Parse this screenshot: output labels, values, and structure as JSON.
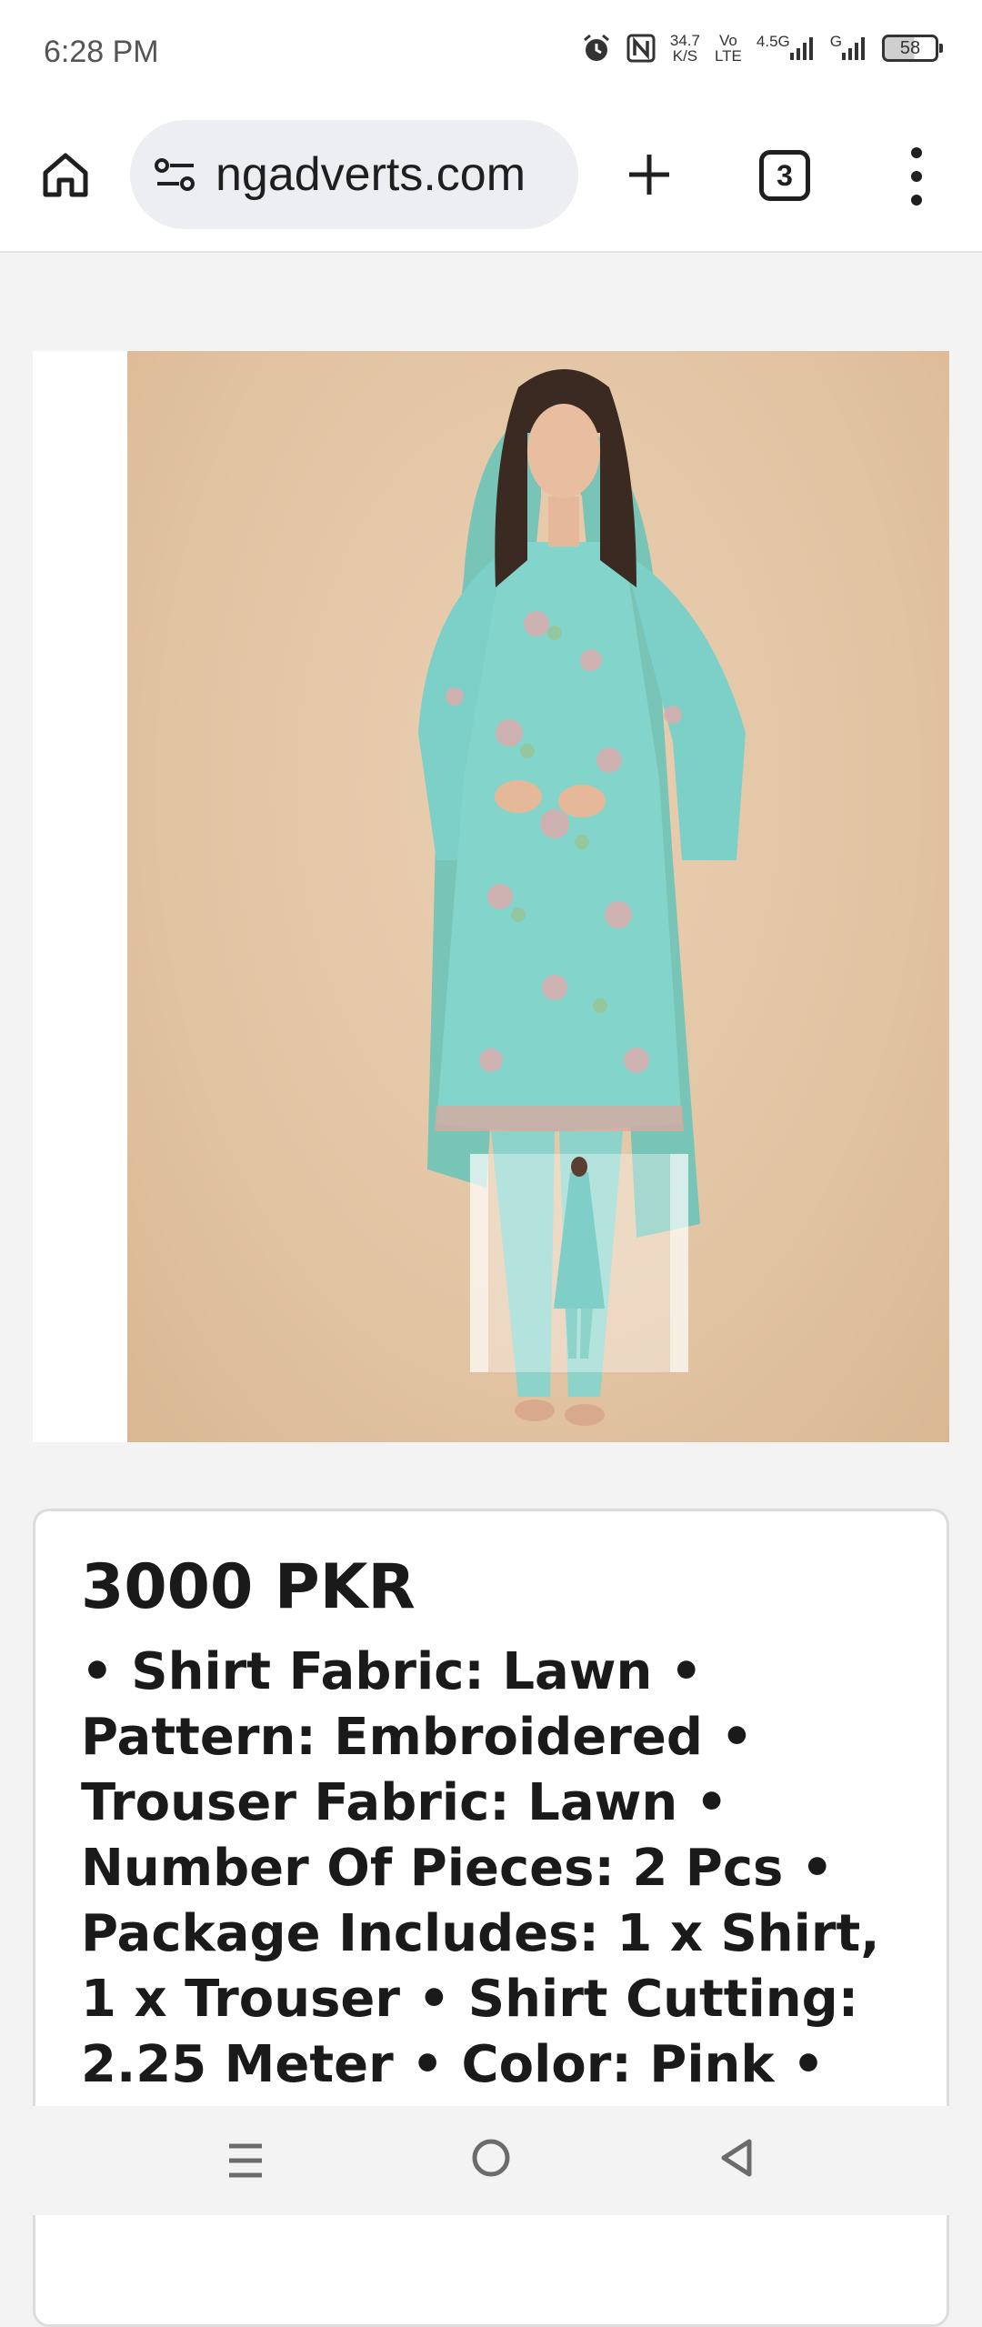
{
  "status_bar": {
    "time": "6:28 PM",
    "net_speed_value": "34.7",
    "net_speed_unit": "K/S",
    "volte_top": "Vo",
    "volte_bottom": "LTE",
    "sim1_label": "4.5G",
    "sim2_label": "G",
    "battery": "58"
  },
  "browser": {
    "url": "ngadverts.com",
    "tab_count": "3"
  },
  "product": {
    "price": "3000 PKR",
    "description": "• Shirt Fabric: Lawn • Pattern: Embroidered • Trouser Fabric: Lawn • Number Of Pieces: 2 Pcs • Package Includes: 1 x Shirt, 1 x Trouser • Shirt Cutting: 2.25 Meter • Color: Pink • Note:"
  },
  "colors": {
    "photo_background": "#e2c4a3",
    "outfit": "#7fcfc8"
  }
}
